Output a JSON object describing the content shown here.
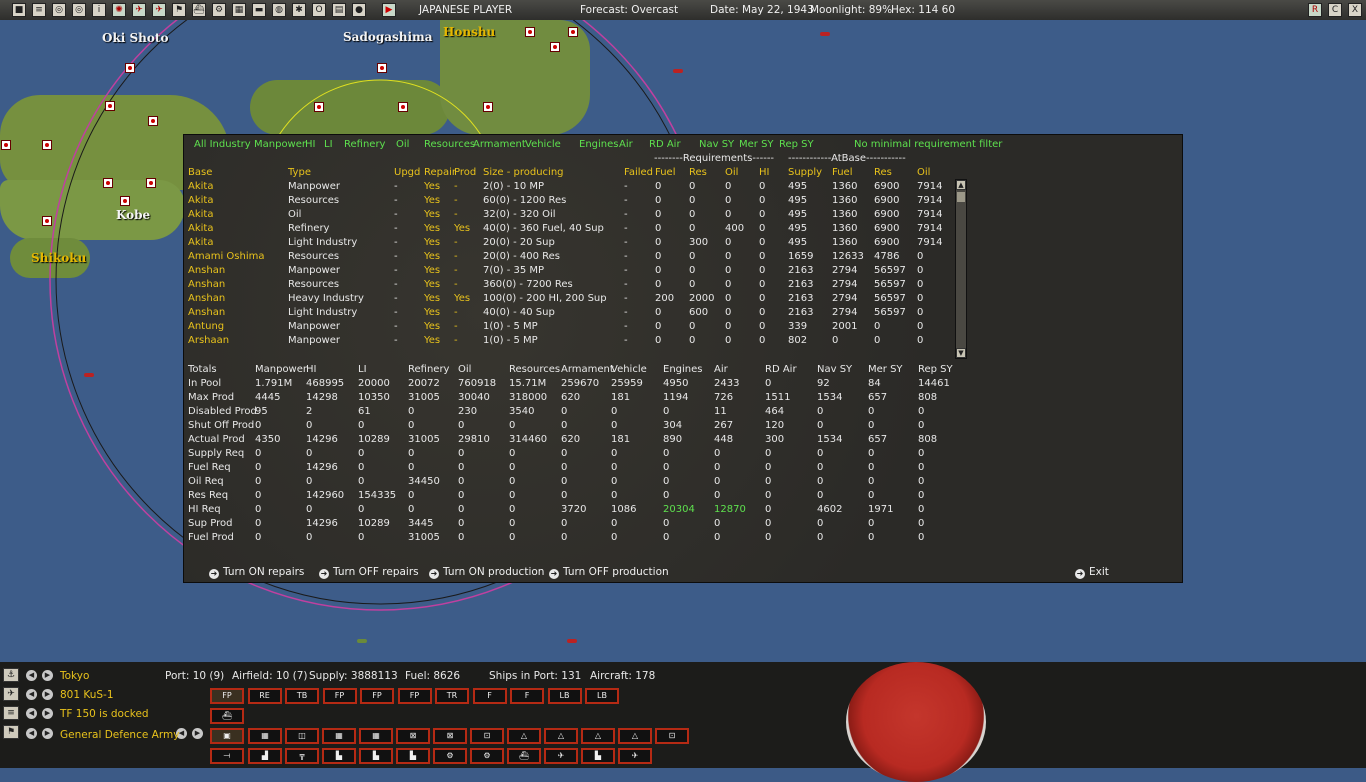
{
  "topbar": {
    "player": "JAPANESE PLAYER",
    "forecast": "Forecast: Overcast",
    "date": "Date: May 22, 1943",
    "moonlight": "Moonlight: 89%",
    "hex": "Hex: 114 60",
    "right_icons": [
      "R",
      "C",
      "X"
    ]
  },
  "map": {
    "labels": {
      "oki_shoto": "Oki Shoto",
      "sadogashima": "Sadogashima",
      "honshu": "Honshu",
      "kobe": "Kobe",
      "shikoku": "Shikoku"
    }
  },
  "filters": [
    "All Industry",
    "Manpower",
    "HI",
    "LI",
    "Refinery",
    "Oil",
    "Resources",
    "Armament",
    "Vehicle",
    "Engines",
    "Air",
    "RD Air",
    "Nav SY",
    "Mer SY",
    "Rep SY",
    "No minimal requirement filter"
  ],
  "group_headers": {
    "requirements": "--------Requirements------",
    "atbase": "------------AtBase-----------"
  },
  "columns": [
    "Base",
    "Type",
    "Upgd",
    "Repair",
    "Prod",
    "Size - producing",
    "Failed",
    "Fuel",
    "Res",
    "Oil",
    "HI",
    "Supply",
    "Fuel",
    "Res",
    "Oil"
  ],
  "rows": [
    [
      "Akita",
      "Manpower",
      "-",
      "Yes",
      "-",
      "2(0) - 10 MP",
      "-",
      "0",
      "0",
      "0",
      "0",
      "495",
      "1360",
      "6900",
      "7914"
    ],
    [
      "Akita",
      "Resources",
      "-",
      "Yes",
      "-",
      "60(0) - 1200 Res",
      "-",
      "0",
      "0",
      "0",
      "0",
      "495",
      "1360",
      "6900",
      "7914"
    ],
    [
      "Akita",
      "Oil",
      "-",
      "Yes",
      "-",
      "32(0) - 320 Oil",
      "-",
      "0",
      "0",
      "0",
      "0",
      "495",
      "1360",
      "6900",
      "7914"
    ],
    [
      "Akita",
      "Refinery",
      "-",
      "Yes",
      "Yes",
      "40(0) - 360 Fuel, 40 Sup",
      "-",
      "0",
      "0",
      "400",
      "0",
      "495",
      "1360",
      "6900",
      "7914"
    ],
    [
      "Akita",
      "Light Industry",
      "-",
      "Yes",
      "-",
      "20(0) - 20 Sup",
      "-",
      "0",
      "300",
      "0",
      "0",
      "495",
      "1360",
      "6900",
      "7914"
    ],
    [
      "Amami Oshima",
      "Resources",
      "-",
      "Yes",
      "-",
      "20(0) - 400 Res",
      "-",
      "0",
      "0",
      "0",
      "0",
      "1659",
      "12633",
      "4786",
      "0"
    ],
    [
      "Anshan",
      "Manpower",
      "-",
      "Yes",
      "-",
      "7(0) - 35 MP",
      "-",
      "0",
      "0",
      "0",
      "0",
      "2163",
      "2794",
      "56597",
      "0"
    ],
    [
      "Anshan",
      "Resources",
      "-",
      "Yes",
      "-",
      "360(0) - 7200 Res",
      "-",
      "0",
      "0",
      "0",
      "0",
      "2163",
      "2794",
      "56597",
      "0"
    ],
    [
      "Anshan",
      "Heavy Industry",
      "-",
      "Yes",
      "Yes",
      "100(0) - 200 HI, 200 Sup",
      "-",
      "200",
      "2000",
      "0",
      "0",
      "2163",
      "2794",
      "56597",
      "0"
    ],
    [
      "Anshan",
      "Light Industry",
      "-",
      "Yes",
      "-",
      "40(0) - 40 Sup",
      "-",
      "0",
      "600",
      "0",
      "0",
      "2163",
      "2794",
      "56597",
      "0"
    ],
    [
      "Antung",
      "Manpower",
      "-",
      "Yes",
      "-",
      "1(0) - 5 MP",
      "-",
      "0",
      "0",
      "0",
      "0",
      "339",
      "2001",
      "0",
      "0"
    ],
    [
      "Arshaan",
      "Manpower",
      "-",
      "Yes",
      "-",
      "1(0) - 5 MP",
      "-",
      "0",
      "0",
      "0",
      "0",
      "802",
      "0",
      "0",
      "0"
    ]
  ],
  "totals": {
    "headers": [
      "Totals",
      "Manpower",
      "HI",
      "LI",
      "Refinery",
      "Oil",
      "Resources",
      "Armament",
      "Vehicle",
      "Engines",
      "Air",
      "RD Air",
      "Nav SY",
      "Mer SY",
      "Rep SY"
    ],
    "rows": [
      [
        "In Pool",
        "1.791M",
        "468995",
        "20000",
        "20072",
        "760918",
        "15.71M",
        "259670",
        "25959",
        "4950",
        "2433",
        "0",
        "92",
        "84",
        "14461"
      ],
      [
        "Max Prod",
        "4445",
        "14298",
        "10350",
        "31005",
        "30040",
        "318000",
        "620",
        "181",
        "1194",
        "726",
        "1511",
        "1534",
        "657",
        "808"
      ],
      [
        "Disabled Prod",
        "95",
        "2",
        "61",
        "0",
        "230",
        "3540",
        "0",
        "0",
        "0",
        "11",
        "464",
        "0",
        "0",
        "0"
      ],
      [
        "Shut Off Prod",
        "0",
        "0",
        "0",
        "0",
        "0",
        "0",
        "0",
        "0",
        "304",
        "267",
        "120",
        "0",
        "0",
        "0"
      ],
      [
        "Actual Prod",
        "4350",
        "14296",
        "10289",
        "31005",
        "29810",
        "314460",
        "620",
        "181",
        "890",
        "448",
        "300",
        "1534",
        "657",
        "808"
      ],
      [
        "Supply Req",
        "0",
        "0",
        "0",
        "0",
        "0",
        "0",
        "0",
        "0",
        "0",
        "0",
        "0",
        "0",
        "0",
        "0"
      ],
      [
        "Fuel Req",
        "0",
        "14296",
        "0",
        "0",
        "0",
        "0",
        "0",
        "0",
        "0",
        "0",
        "0",
        "0",
        "0",
        "0"
      ],
      [
        "Oil Req",
        "0",
        "0",
        "0",
        "34450",
        "0",
        "0",
        "0",
        "0",
        "0",
        "0",
        "0",
        "0",
        "0",
        "0"
      ],
      [
        "Res Req",
        "0",
        "142960",
        "154335",
        "0",
        "0",
        "0",
        "0",
        "0",
        "0",
        "0",
        "0",
        "0",
        "0",
        "0"
      ],
      [
        "HI Req",
        "0",
        "0",
        "0",
        "0",
        "0",
        "0",
        "3720",
        "1086",
        "20304",
        "12870",
        "0",
        "4602",
        "1971",
        "0"
      ],
      [
        "Sup Prod",
        "0",
        "14296",
        "10289",
        "3445",
        "0",
        "0",
        "0",
        "0",
        "0",
        "0",
        "0",
        "0",
        "0",
        "0"
      ],
      [
        "Fuel Prod",
        "0",
        "0",
        "0",
        "31005",
        "0",
        "0",
        "0",
        "0",
        "0",
        "0",
        "0",
        "0",
        "0",
        "0"
      ]
    ]
  },
  "actions": {
    "repairs_on": "Turn ON repairs",
    "repairs_off": "Turn OFF repairs",
    "production_on": "Turn ON production",
    "production_off": "Turn OFF production",
    "exit": "Exit"
  },
  "bottom": {
    "base_name": "Tokyo",
    "port": "Port: 10 (9)",
    "airfield": "Airfield: 10 (7)",
    "supply": "Supply: 3888113",
    "fuel": "Fuel: 8626",
    "ships": "Ships in Port: 131",
    "aircraft": "Aircraft: 178",
    "air_unit": "801 KuS-1",
    "task_force": "TF 150 is docked",
    "land_unit": "General Defence Army",
    "air_buttons": [
      "FP",
      "RE",
      "TB",
      "FP",
      "FP",
      "FP",
      "TR",
      "F",
      "F",
      "LB",
      "LB"
    ]
  },
  "colors": {
    "highlight_green": "#5ee04e",
    "base_yellow": "#e8c21c",
    "button_border": "#b52a14"
  }
}
